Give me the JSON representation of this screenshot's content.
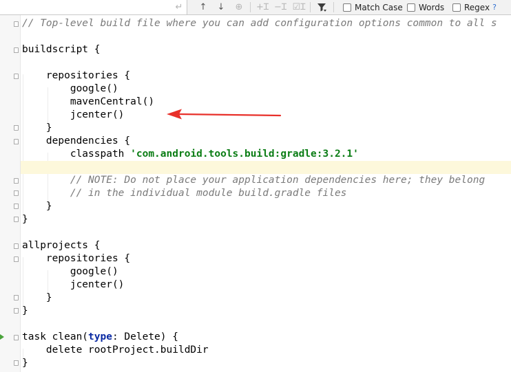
{
  "toolbar": {
    "options": [
      {
        "label": "Match Case"
      },
      {
        "label": "Words"
      },
      {
        "label": "Regex"
      }
    ],
    "help_label": "?"
  },
  "code": {
    "lines": [
      {
        "text": "// Top-level build file where you can add configuration options common to all s",
        "type": "comment"
      },
      {
        "text": ""
      },
      {
        "text": "buildscript {"
      },
      {
        "text": ""
      },
      {
        "text": "    repositories {"
      },
      {
        "text": "        google()"
      },
      {
        "text": "        mavenCentral()"
      },
      {
        "text": "        jcenter()"
      },
      {
        "text": "    }"
      },
      {
        "text": "    dependencies {"
      },
      {
        "text": "        classpath ",
        "string": "'com.android.tools.build:gradle:3.2.1'"
      },
      {
        "text": ""
      },
      {
        "text": "        // NOTE: Do not place your application dependencies here; they belong",
        "type": "comment"
      },
      {
        "text": "        // in the individual module build.gradle files",
        "type": "comment"
      },
      {
        "text": "    }"
      },
      {
        "text": "}"
      },
      {
        "text": ""
      },
      {
        "text": "allprojects {"
      },
      {
        "text": "    repositories {"
      },
      {
        "text": "        google()"
      },
      {
        "text": "        jcenter()"
      },
      {
        "text": "    }"
      },
      {
        "text": "}"
      },
      {
        "text": ""
      },
      {
        "text": "task clean(",
        "keyword": "type",
        "after": ": Delete) {"
      },
      {
        "text": "    delete rootProject.buildDir"
      },
      {
        "text": "}"
      }
    ],
    "current_line": 11
  },
  "annotation": {
    "color": "#e8302a",
    "points_to": "mavenCentral()"
  },
  "colors": {
    "comment": "#7a7a7a",
    "string": "#0b7d15",
    "keyword": "#0a2aa3",
    "current_line": "#fdf8db"
  }
}
